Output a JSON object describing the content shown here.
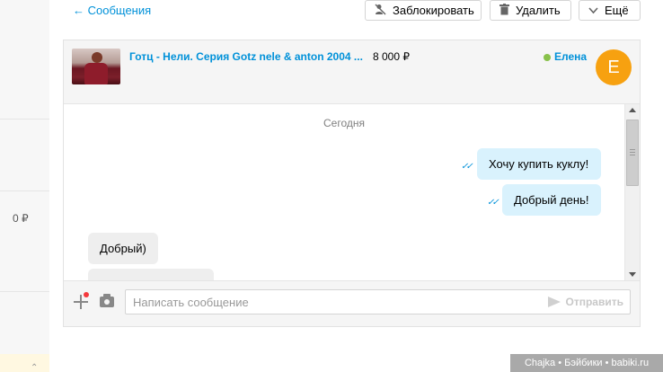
{
  "topbar": {
    "back_label": "← Сообщения",
    "block_label": "Заблокировать",
    "delete_label": "Удалить",
    "more_label": "Ещё"
  },
  "left": {
    "price_fragment": "0 ₽"
  },
  "chat": {
    "item_title": "Готц - Нели. Серия Gotz nele & anton 2004 ...",
    "item_price": "8 000 ₽",
    "seller_name": "Елена",
    "avatar_letter": "Е",
    "online_color": "#88c14a",
    "date_separator": "Сегодня",
    "messages": [
      {
        "direction": "out",
        "text": "Хочу купить куклу!",
        "status": "read"
      },
      {
        "direction": "out",
        "text": "Добрый день!",
        "status": "read"
      },
      {
        "direction": "in",
        "text": "Добрый)"
      },
      {
        "direction": "in",
        "text": ""
      }
    ]
  },
  "composer": {
    "placeholder": "Написать сообщение",
    "send_label": "Отправить"
  },
  "watermark": "Chajka • Бэйбики • babiki.ru",
  "colors": {
    "accent": "#0091d9",
    "avatar": "#f7a110",
    "outgoing_bubble": "#d9f2fd",
    "incoming_bubble": "#eeeeee"
  }
}
